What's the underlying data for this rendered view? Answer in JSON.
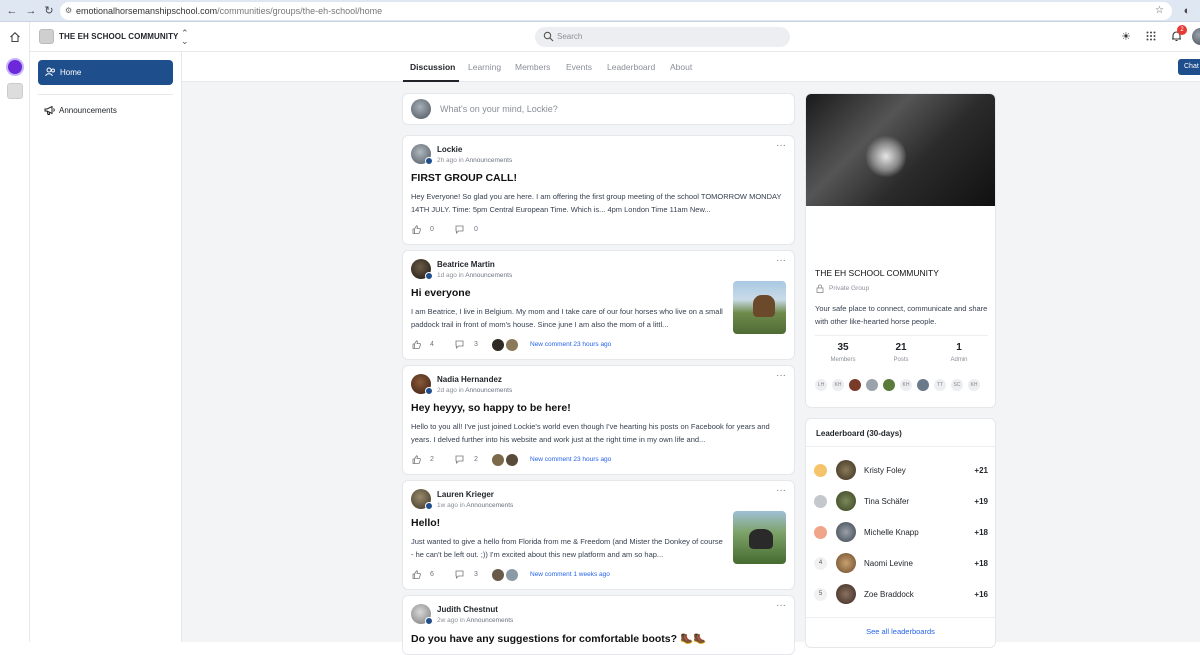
{
  "browser": {
    "url_domain": "emotionalhorsemanshipschool.com",
    "url_path": "/communities/groups/the-eh-school/home"
  },
  "header": {
    "community_name": "THE EH SCHOOL COMMUNITY",
    "search_placeholder": "Search",
    "notification_count": "2",
    "chat_label": "Chat"
  },
  "sidebar": {
    "items": [
      {
        "label": "Home",
        "icon": "people-icon",
        "active": true
      },
      {
        "label": "Announcements",
        "icon": "megaphone-icon",
        "active": false
      }
    ]
  },
  "tabs": [
    "Discussion",
    "Learning",
    "Members",
    "Events",
    "Leaderboard",
    "About"
  ],
  "composer": {
    "placeholder": "What's on your mind, Lockie?"
  },
  "posts": [
    {
      "author": "Lockie",
      "time": "2h ago",
      "in_label": "in",
      "group": "Announcements",
      "title": "FIRST GROUP CALL!",
      "body": "Hey Everyone! So glad you are here. I am offering the first group meeting of the school TOMORROW MONDAY 14TH JULY. Time: 5pm Central European Time. Which is... 4pm London Time 11am New...",
      "likes": "0",
      "comments": "0",
      "new_comment": ""
    },
    {
      "author": "Beatrice Martin",
      "time": "1d ago",
      "in_label": "in",
      "group": "Announcements",
      "title": "Hi everyone",
      "body": "I am Beatrice, I live in Belgium. My mom and I take care of our four horses who live on a small paddock trail in front of mom's house. Since june I am also the mom of a littl...",
      "likes": "4",
      "comments": "3",
      "new_comment": "New comment 23 hours ago"
    },
    {
      "author": "Nadia Hernandez",
      "time": "2d ago",
      "in_label": "in",
      "group": "Announcements",
      "title": "Hey heyyy, so happy to be here!",
      "body": "Hello to you all! I've just joined Lockie's world even though I've hearting his posts on Facebook for years and years. I delved further into his website and work just at the right time in my own life and...",
      "likes": "2",
      "comments": "2",
      "new_comment": "New comment 23 hours ago"
    },
    {
      "author": "Lauren Krieger",
      "time": "1w ago",
      "in_label": "in",
      "group": "Announcements",
      "title": "Hello!",
      "body": "Just wanted to give a hello from Florida from me & Freedom (and Mister the Donkey of course - he can't be left out. ;)) I'm excited about this new platform and am so hap...",
      "likes": "6",
      "comments": "3",
      "new_comment": "New comment 1 weeks ago"
    },
    {
      "author": "Judith Chestnut",
      "time": "2w ago",
      "in_label": "in",
      "group": "Announcements",
      "title": "Do you have any suggestions for comfortable boots? 🥾🥾",
      "body": "",
      "likes": "",
      "comments": "",
      "new_comment": ""
    }
  ],
  "about": {
    "name": "THE EH SCHOOL COMMUNITY",
    "privacy": "Private Group",
    "description": "Your safe place to connect, communicate and share with other like-hearted horse people.",
    "stats": [
      {
        "value": "35",
        "label": "Members"
      },
      {
        "value": "21",
        "label": "Posts"
      },
      {
        "value": "1",
        "label": "Admin"
      }
    ],
    "member_initials": [
      "LH",
      "KH",
      "",
      "",
      "",
      "KH",
      "",
      "TT",
      "SC",
      "KH"
    ]
  },
  "leaderboard": {
    "title": "Leaderboard (30-days)",
    "entries": [
      {
        "rank": "",
        "name": "Kristy Foley",
        "points": "+21"
      },
      {
        "rank": "",
        "name": "Tina Schäfer",
        "points": "+19"
      },
      {
        "rank": "",
        "name": "Michelle Knapp",
        "points": "+18"
      },
      {
        "rank": "4",
        "name": "Naomi Levine",
        "points": "+18"
      },
      {
        "rank": "5",
        "name": "Zoe Braddock",
        "points": "+16"
      }
    ],
    "see_all": "See all leaderboards"
  },
  "colors": {
    "accent": "#1e4e8c",
    "link": "#2563eb",
    "notification": "#e53935"
  }
}
